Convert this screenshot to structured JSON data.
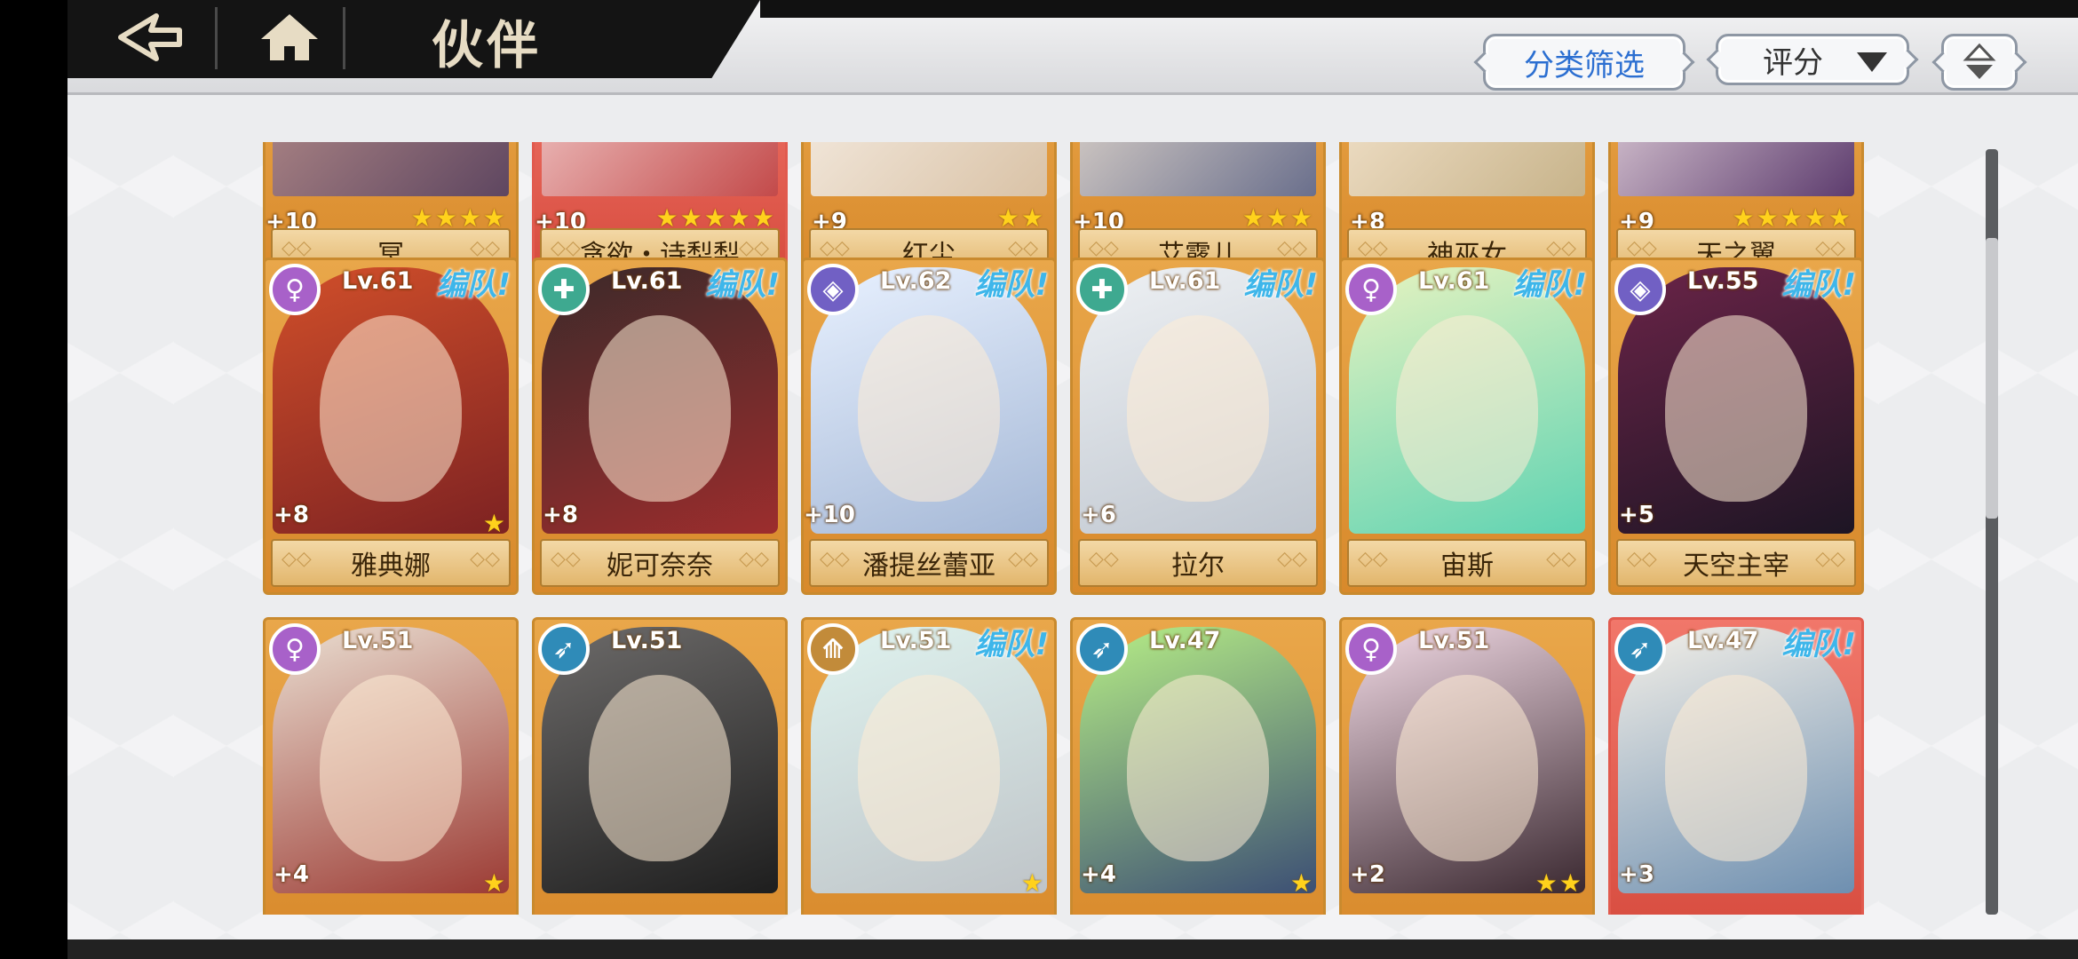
{
  "header": {
    "title": "伙伴",
    "filter_label": "分类筛选",
    "sort_label": "评分"
  },
  "icons": {
    "back": "back-arrow-icon",
    "home": "home-icon",
    "sort_order": "sort-order-icon",
    "sort_caret": "caret-down-icon"
  },
  "class_colors": {
    "support": "#a861c9",
    "healer": "#3ea990",
    "tank": "#7160c4",
    "archer": "#2f8bb8",
    "mage": "#c28b3a"
  },
  "row0": [
    {
      "plus": "+10",
      "stars": "★★★★",
      "name": "冥"
    },
    {
      "plus": "+10",
      "stars": "★★★★★",
      "name": "贪欲・诗梨梨"
    },
    {
      "plus": "+9",
      "stars": "★★",
      "name": "红尘"
    },
    {
      "plus": "+10",
      "stars": "★★★",
      "name": "艾露儿"
    },
    {
      "plus": "+8",
      "stars": "",
      "name": "神巫女"
    },
    {
      "plus": "+9",
      "stars": "★★★★★",
      "name": "天之翼"
    }
  ],
  "row1": [
    {
      "icon": "♀",
      "lv": "Lv.61",
      "team": "编队!",
      "plus": "+8",
      "stars": "★",
      "name": "雅典娜"
    },
    {
      "icon": "✚",
      "lv": "Lv.61",
      "team": "编队!",
      "plus": "+8",
      "stars": "",
      "name": "妮可奈奈"
    },
    {
      "icon": "◈",
      "lv": "Lv.62",
      "team": "编队!",
      "plus": "+10",
      "stars": "",
      "name": "潘提丝蕾亚"
    },
    {
      "icon": "✚",
      "lv": "Lv.61",
      "team": "编队!",
      "plus": "+6",
      "stars": "",
      "name": "拉尔"
    },
    {
      "icon": "♀",
      "lv": "Lv.61",
      "team": "编队!",
      "plus": "",
      "stars": "",
      "name": "宙斯"
    },
    {
      "icon": "◈",
      "lv": "Lv.55",
      "team": "编队!",
      "plus": "+5",
      "stars": "",
      "name": "天空主宰"
    }
  ],
  "row2": [
    {
      "icon": "♀",
      "lv": "Lv.51",
      "team": "",
      "plus": "+4",
      "stars": "★"
    },
    {
      "icon": "➶",
      "lv": "Lv.51",
      "team": "",
      "plus": "",
      "stars": ""
    },
    {
      "icon": "⟰",
      "lv": "Lv.51",
      "team": "编队!",
      "plus": "",
      "stars": "★"
    },
    {
      "icon": "➶",
      "lv": "Lv.47",
      "team": "",
      "plus": "+4",
      "stars": "★"
    },
    {
      "icon": "♀",
      "lv": "Lv.51",
      "team": "",
      "plus": "+2",
      "stars": "★★"
    },
    {
      "icon": "➶",
      "lv": "Lv.47",
      "team": "编队!",
      "plus": "+3",
      "stars": ""
    }
  ]
}
